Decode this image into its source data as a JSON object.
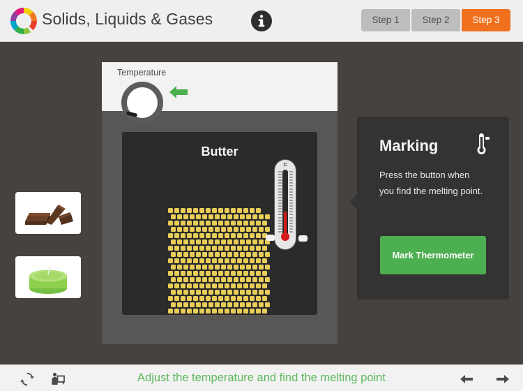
{
  "header": {
    "title": "Solids, Liquids & Gases",
    "logo_name": "colored-c-logo",
    "info_icon": "info-icon",
    "steps": [
      {
        "label": "Step 1",
        "active": false
      },
      {
        "label": "Step 2",
        "active": false
      },
      {
        "label": "Step 3",
        "active": true
      }
    ],
    "active_step_color": "#f0701e",
    "inactive_step_color": "#bdbdbd"
  },
  "sidebar": {
    "thumbnails": [
      {
        "name": "chocolate",
        "alt": "chocolate-pieces"
      },
      {
        "name": "candle",
        "alt": "green-candle"
      }
    ]
  },
  "apparatus": {
    "temperature_label": "Temperature",
    "dial_name": "temperature-dial",
    "hint_arrow": "green-left-arrow",
    "substance_name": "Butter",
    "particle_color": "#e8cd57",
    "particle_rows": 17,
    "particle_cols": 15,
    "thermometer": {
      "unit_label": "C",
      "mercury_color": "#d71a1a",
      "marker_left": "thermometer-marker-left",
      "marker_right": "thermometer-marker-right"
    }
  },
  "marking_panel": {
    "title": "Marking",
    "icon": "thermometer-icon",
    "body": "Press the button when you find the melting point.",
    "button_label": "Mark Thermometer",
    "button_color": "#4caf50",
    "panel_color": "#333333"
  },
  "footer": {
    "refresh_icon": "refresh-icon",
    "present_icon": "presenter-board-icon",
    "instruction": "Adjust the temperature and find the melting point",
    "instruction_color": "#5cb85c",
    "prev_icon": "arrow-left-icon",
    "next_icon": "arrow-right-icon"
  }
}
